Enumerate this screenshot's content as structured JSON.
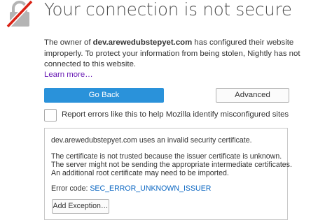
{
  "page": {
    "icon": "broken-lock-icon",
    "title": "Your connection is not secure",
    "desc_prefix": "The owner of ",
    "domain": "dev.arewedubstepyet.com",
    "desc_suffix": " has configured their website improperly. To protect your information from being stolen, Nightly has not connected to this website.",
    "learn_more": "Learn more…"
  },
  "actions": {
    "go_back": "Go Back",
    "advanced": "Advanced"
  },
  "report": {
    "checked": false,
    "label": "Report errors like this to help Mozilla identify misconfigured sites"
  },
  "details": {
    "line1": "dev.arewedubstepyet.com uses an invalid security certificate.",
    "line2": "The certificate is not trusted because the issuer certificate is unknown.",
    "line3": "The server might not be sending the appropriate intermediate certificates.",
    "line4": "An additional root certificate may need to be imported.",
    "error_label": "Error code: ",
    "error_code": "SEC_ERROR_UNKNOWN_ISSUER",
    "add_exception": "Add Exception…"
  },
  "colors": {
    "primary_button": "#2a92da",
    "link": "#6a1bb5",
    "error_code": "#0a66c2",
    "lock_grey": "#b4b4b4",
    "lock_slash": "#d92215"
  }
}
